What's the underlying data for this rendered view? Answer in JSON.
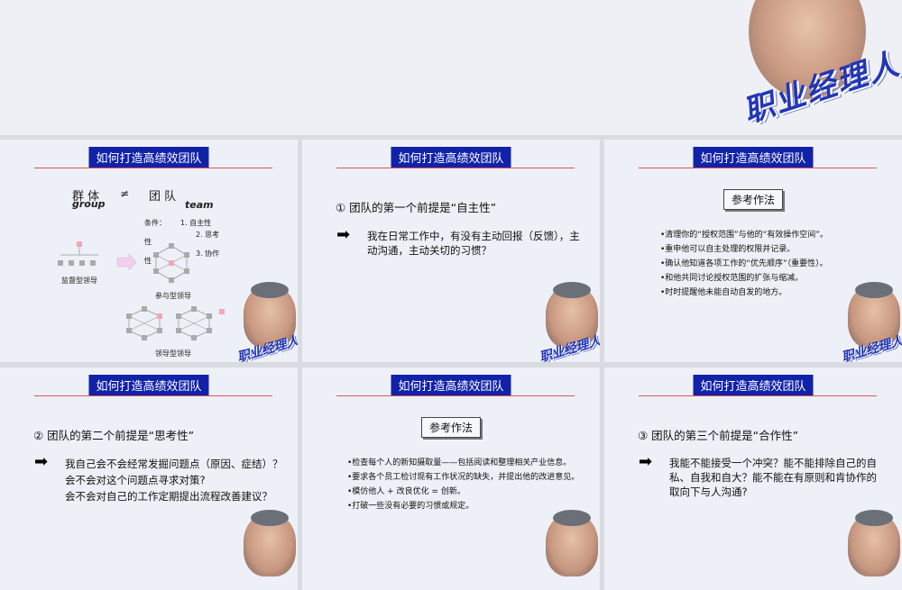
{
  "top": {
    "logo": "职业经理人"
  },
  "slides": [
    {
      "title": "如何打造高绩效团队",
      "diagram": {
        "group_cn": "群 体",
        "neq": "≠",
        "team_cn": "团 队",
        "group_en": "group",
        "team_en": "team",
        "cond_label": "条件：",
        "cond1": "1. 自主性",
        "cond2": "2. 思考",
        "cond_xing1": "性",
        "cond3": "3. 协作",
        "cond_xing2": "性",
        "label_supervise": "监督型领导",
        "label_participate": "参与型领导",
        "label_lead": "领导型领导"
      },
      "logo": "职业经理人"
    },
    {
      "title": "如何打造高绩效团队",
      "premise": "① 团队的第一个前提是“自主性”",
      "arrow": "➡",
      "body": [
        "我在日常工作中，有没有主动回报（反馈），主",
        "动沟通，主动关切的习惯？"
      ],
      "logo": "职业经理人"
    },
    {
      "title": "如何打造高绩效团队",
      "ref": "参考作法",
      "bullets": [
        "•清理你的“授权范围”与他的“有效操作空间”。",
        "•重申他可以自主处理的权限并记录。",
        "•确认他知道各项工作的“优先顺序”（重要性）。",
        "•和他共同讨论授权范围的扩张与缩减。",
        "•时时提醒他未能自动自发的地方。"
      ],
      "logo": "职业经理人"
    },
    {
      "title": "如何打造高绩效团队",
      "premise": "② 团队的第二个前提是“思考性”",
      "arrow": "➡",
      "body": [
        "我自己会不会经常发掘问题点（原因、症结）？",
        "会不会对这个问题点寻求对策?",
        "会不会对自己的工作定期提出流程改善建议？"
      ]
    },
    {
      "title": "如何打造高绩效团队",
      "ref": "参考作法",
      "bullets": [
        "•检查每个人的新知摄取量——包括阅读和整理相关产业信息。",
        "•要求各个员工检讨现有工作状况的缺失，并提出他的改进意见。",
        "•模仿他人  +  改良优化  =  创新。",
        "•打破一些没有必要的习惯或规定。"
      ]
    },
    {
      "title": "如何打造高绩效团队",
      "premise": "③ 团队的第三个前提是“合作性”",
      "arrow": "➡",
      "body": [
        "我能不能接受一个冲突？能不能排除自己的自",
        "私、自我和自大？能不能在有原则和肯协作的",
        "取向下与人沟通?"
      ]
    }
  ],
  "colors": {
    "title_bg": "#1122a8",
    "rule": "#d9535a",
    "logo": "#2336b5"
  }
}
